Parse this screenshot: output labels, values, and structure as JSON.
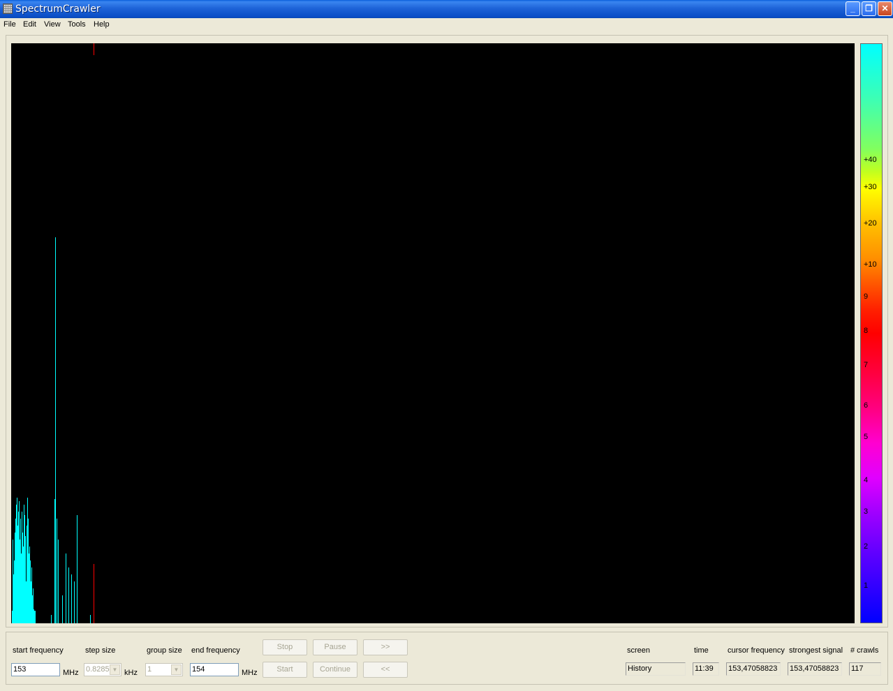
{
  "window": {
    "title": "SpectrumCrawler"
  },
  "menu": [
    "File",
    "Edit",
    "View",
    "Tools",
    "Help"
  ],
  "colorbar": {
    "labels": [
      "+40",
      "+30",
      "+20",
      "+10",
      "9",
      "8",
      "7",
      "6",
      "5",
      "4",
      "3",
      "2",
      "1"
    ]
  },
  "spectrum": {
    "marker_color": "#ff0000",
    "signal_color": "#00ffff"
  },
  "controls": {
    "start_frequency": {
      "label": "start frequency",
      "value": "153",
      "unit": "MHz"
    },
    "step_size": {
      "label": "step size",
      "value": "0.8285",
      "unit": "kHz"
    },
    "group_size": {
      "label": "group size",
      "value": "1"
    },
    "end_frequency": {
      "label": "end frequency",
      "value": "154",
      "unit": "MHz"
    },
    "buttons": {
      "stop": "Stop",
      "pause": "Pause",
      "forward": ">>",
      "start": "Start",
      "continue": "Continue",
      "back": "<<"
    },
    "screen": {
      "label": "screen",
      "value": "History"
    },
    "time": {
      "label": "time",
      "value": "11:39"
    },
    "cursor_frequency": {
      "label": "cursor frequency",
      "value": "153,47058823"
    },
    "strongest_signal": {
      "label": "strongest signal",
      "value": "153,47058823"
    },
    "crawls": {
      "label": "# crawls",
      "value": "117"
    }
  }
}
